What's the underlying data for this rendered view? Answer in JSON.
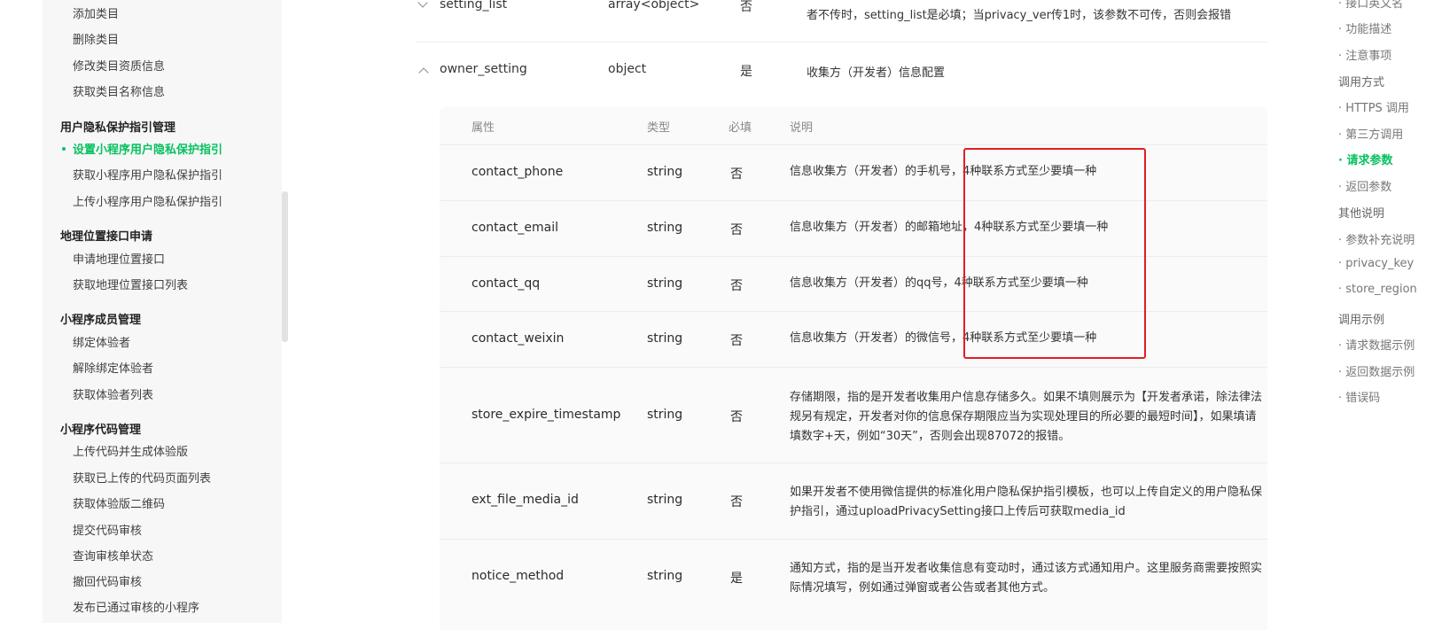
{
  "sidebar": {
    "top_items": [
      "添加类目",
      "删除类目",
      "修改类目资质信息",
      "获取类目名称信息"
    ],
    "groups": [
      {
        "title": "用户隐私保护指引管理",
        "items": [
          "设置小程序用户隐私保护指引",
          "获取小程序用户隐私保护指引",
          "上传小程序用户隐私保护指引"
        ]
      },
      {
        "title": "地理位置接口申请",
        "items": [
          "申请地理位置接口",
          "获取地理位置接口列表"
        ]
      },
      {
        "title": "小程序成员管理",
        "items": [
          "绑定体验者",
          "解除绑定体验者",
          "获取体验者列表"
        ]
      },
      {
        "title": "小程序代码管理",
        "items": [
          "上传代码并生成体验版",
          "获取已上传的代码页面列表",
          "获取体验版二维码",
          "提交代码审核",
          "查询审核单状态",
          "撤回代码审核",
          "发布已通过审核的小程序"
        ]
      }
    ],
    "active_item": "设置小程序用户隐私保护指引"
  },
  "main": {
    "params": [
      {
        "name": "setting_list",
        "type": "array<object>",
        "required": "否",
        "desc": "者不传时，setting_list是必填；当privacy_ver传1时，该参数不可传，否则会报错"
      },
      {
        "name": "owner_setting",
        "type": "object",
        "required": "是",
        "desc": "收集方（开发者）信息配置"
      }
    ],
    "sub_table": {
      "headers": {
        "name": "属性",
        "type": "类型",
        "required": "必填",
        "desc": "说明"
      },
      "rows": [
        {
          "name": "contact_phone",
          "type": "string",
          "required": "否",
          "desc": "信息收集方（开发者）的手机号，4种联系方式至少要填一种"
        },
        {
          "name": "contact_email",
          "type": "string",
          "required": "否",
          "desc": "信息收集方（开发者）的邮箱地址，4种联系方式至少要填一种"
        },
        {
          "name": "contact_qq",
          "type": "string",
          "required": "否",
          "desc": "信息收集方（开发者）的qq号，4种联系方式至少要填一种"
        },
        {
          "name": "contact_weixin",
          "type": "string",
          "required": "否",
          "desc": "信息收集方（开发者）的微信号，4种联系方式至少要填一种"
        },
        {
          "name": "store_expire_timestamp",
          "type": "string",
          "required": "否",
          "desc": "存储期限，指的是开发者收集用户信息存储多久。如果不填则展示为【开发者承诺，除法律法规另有规定，开发者对你的信息保存期限应当为实现处理目的所必要的最短时间】，如果填请填数字+天，例如“30天”，否则会出现87072的报错。"
        },
        {
          "name": "ext_file_media_id",
          "type": "string",
          "required": "否",
          "desc": "如果开发者不使用微信提供的标准化用户隐私保护指引模板，也可以上传自定义的用户隐私保护指引，通过uploadPrivacySetting接口上传后可获取media_id"
        },
        {
          "name": "notice_method",
          "type": "string",
          "required": "是",
          "desc": "通知方式，指的是当开发者收集信息有变动时，通过该方式通知用户。这里服务商需要按照实际情况填写，例如通过弹窗或者公告或者其他方式。"
        }
      ]
    }
  },
  "toc": {
    "items": [
      {
        "label": "· 接口英文名",
        "level": "sub"
      },
      {
        "label": "· 功能描述",
        "level": "sub"
      },
      {
        "label": "· 注意事项",
        "level": "sub"
      },
      {
        "label": "调用方式",
        "level": "top"
      },
      {
        "label": "· HTTPS 调用",
        "level": "sub"
      },
      {
        "label": "· 第三方调用",
        "level": "sub"
      },
      {
        "label": "· 请求参数",
        "level": "sub",
        "active": true
      },
      {
        "label": "· 返回参数",
        "level": "sub"
      },
      {
        "label": "其他说明",
        "level": "top"
      },
      {
        "label": "· 参数补充说明",
        "level": "sub"
      },
      {
        "label": "· privacy_key",
        "level": "sub"
      },
      {
        "label": "· store_region",
        "level": "sub"
      },
      {
        "label": "调用示例",
        "level": "top"
      },
      {
        "label": "· 请求数据示例",
        "level": "sub"
      },
      {
        "label": "· 返回数据示例",
        "level": "sub"
      },
      {
        "label": "· 错误码",
        "level": "sub"
      }
    ]
  },
  "colors": {
    "accent": "#07c160",
    "highlight_box": "#e02020"
  }
}
